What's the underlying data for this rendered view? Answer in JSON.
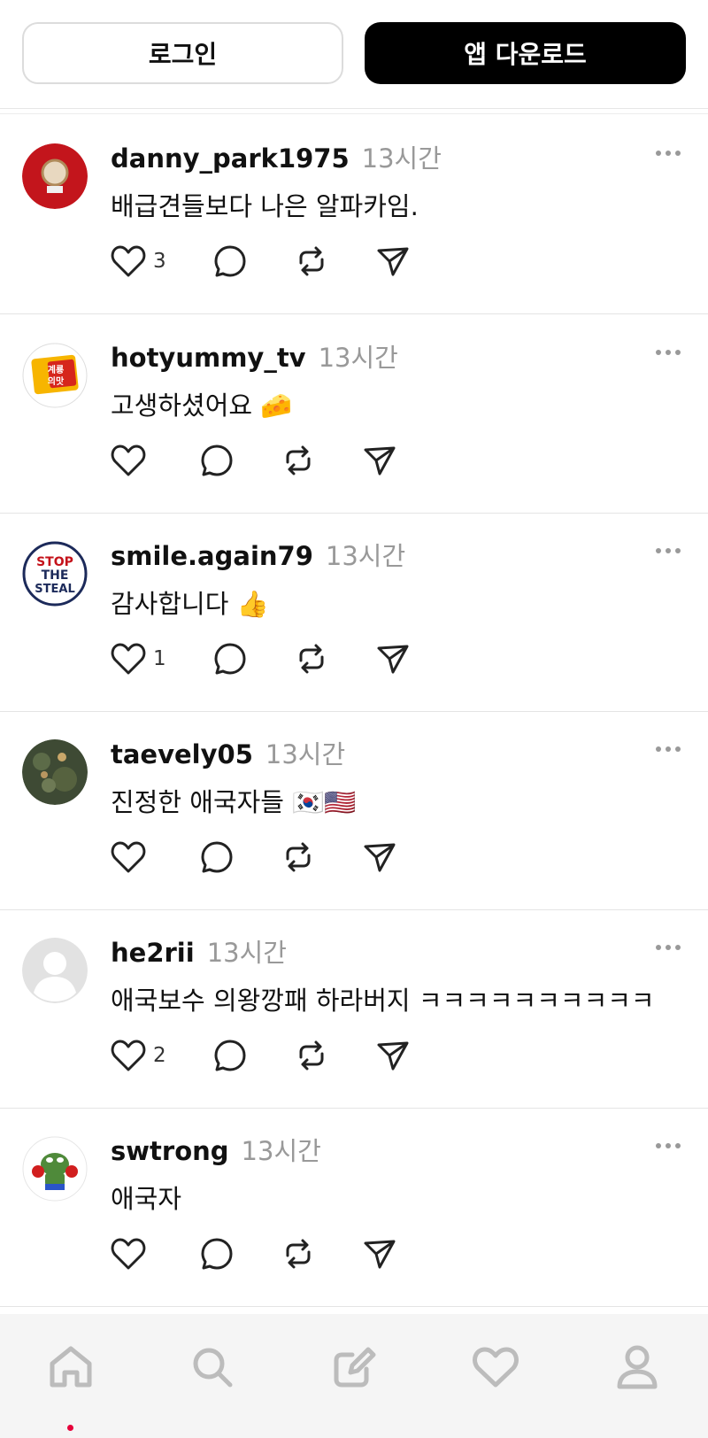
{
  "topbar": {
    "login_label": "로그인",
    "download_label": "앱 다운로드"
  },
  "posts": [
    {
      "username": "danny_park1975",
      "time": "13시간",
      "text": "배급견들보다 나은 알파카임.",
      "likes": "3",
      "avatar": "red-emblem-avatar"
    },
    {
      "username": "hotyummy_tv",
      "time": "13시간",
      "text": "고생하셨어요 🧀",
      "likes": "",
      "avatar": "channel-logo-avatar",
      "avatar_text": "계룡 의맛"
    },
    {
      "username": "smile.again79",
      "time": "13시간",
      "text": "감사합니다 👍",
      "likes": "1",
      "avatar": "stop-the-steal-avatar",
      "avatar_text": "STOP THE STEAL"
    },
    {
      "username": "taevely05",
      "time": "13시간",
      "text": "진정한 애국자들 🇰🇷🇺🇸",
      "likes": "",
      "avatar": "tree-photo-avatar"
    },
    {
      "username": "he2rii",
      "time": "13시간",
      "text": "애국보수 의왕깡패 하라버지 ㅋㅋㅋㅋㅋㅋㅋㅋㅋㅋ",
      "likes": "2",
      "avatar": "default-user-avatar"
    },
    {
      "username": "swtrong",
      "time": "13시간",
      "text": "애국자",
      "likes": "",
      "avatar": "frog-boxer-avatar"
    }
  ],
  "nav": [
    "home-icon",
    "search-icon",
    "compose-icon",
    "activity-heart-icon",
    "profile-icon"
  ],
  "colors": {
    "accent_dot": "#e6003a",
    "time_gray": "#999999"
  }
}
